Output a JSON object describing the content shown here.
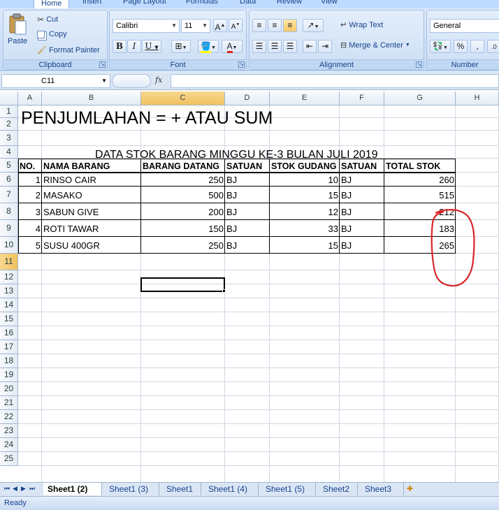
{
  "ribbon": {
    "tabs": [
      "Home",
      "Insert",
      "Page Layout",
      "Formulas",
      "Data",
      "Review",
      "View"
    ],
    "clipboard": {
      "paste_label": "Paste",
      "cut_label": "Cut",
      "copy_label": "Copy",
      "format_painter_label": "Format Painter",
      "group_label": "Clipboard"
    },
    "font": {
      "font_name": "Calibri",
      "font_size": "11",
      "group_label": "Font"
    },
    "alignment": {
      "wrap_text_label": "Wrap Text",
      "merge_center_label": "Merge & Center",
      "group_label": "Alignment"
    },
    "number": {
      "format": "General",
      "percent_label": "%",
      "comma_label": ",",
      "group_label": "Number"
    }
  },
  "formula_bar": {
    "name_box": "C11",
    "fx_label": "fx",
    "formula": ""
  },
  "sheet": {
    "columns": [
      "A",
      "B",
      "C",
      "D",
      "E",
      "F",
      "G",
      "H"
    ],
    "rows": [
      "1",
      "2",
      "3",
      "4",
      "5",
      "6",
      "7",
      "8",
      "9",
      "10",
      "11",
      "12",
      "13",
      "14",
      "15",
      "16",
      "17",
      "18",
      "19",
      "20",
      "21",
      "22",
      "23",
      "24",
      "25"
    ],
    "title": "PENJUMLAHAN = + ATAU SUM",
    "subtitle": "DATA STOK BARANG MINGGU KE-3 BULAN JULI 2019",
    "headers": [
      "NO.",
      "NAMA BARANG",
      "BARANG DATANG",
      "SATUAN",
      "STOK GUDANG",
      "SATUAN",
      "TOTAL STOK"
    ],
    "data_rows": [
      [
        "1",
        "RINSO CAIR",
        "250",
        "BJ",
        "10",
        "BJ",
        "260"
      ],
      [
        "2",
        "MASAKO",
        "500",
        "BJ",
        "15",
        "BJ",
        "515"
      ],
      [
        "3",
        "SABUN GIVE",
        "200",
        "BJ",
        "12",
        "BJ",
        "212"
      ],
      [
        "4",
        "ROTI TAWAR",
        "150",
        "BJ",
        "33",
        "BJ",
        "183"
      ],
      [
        "5",
        "SUSU 400GR",
        "250",
        "BJ",
        "15",
        "BJ",
        "265"
      ]
    ],
    "annotation_color": "#d9262a"
  },
  "sheet_tabs": [
    "Sheet1 (2)",
    "Sheet1 (3)",
    "Sheet1",
    "Sheet1 (4)",
    "Sheet1 (5)",
    "Sheet2",
    "Sheet3"
  ],
  "status": "Ready"
}
